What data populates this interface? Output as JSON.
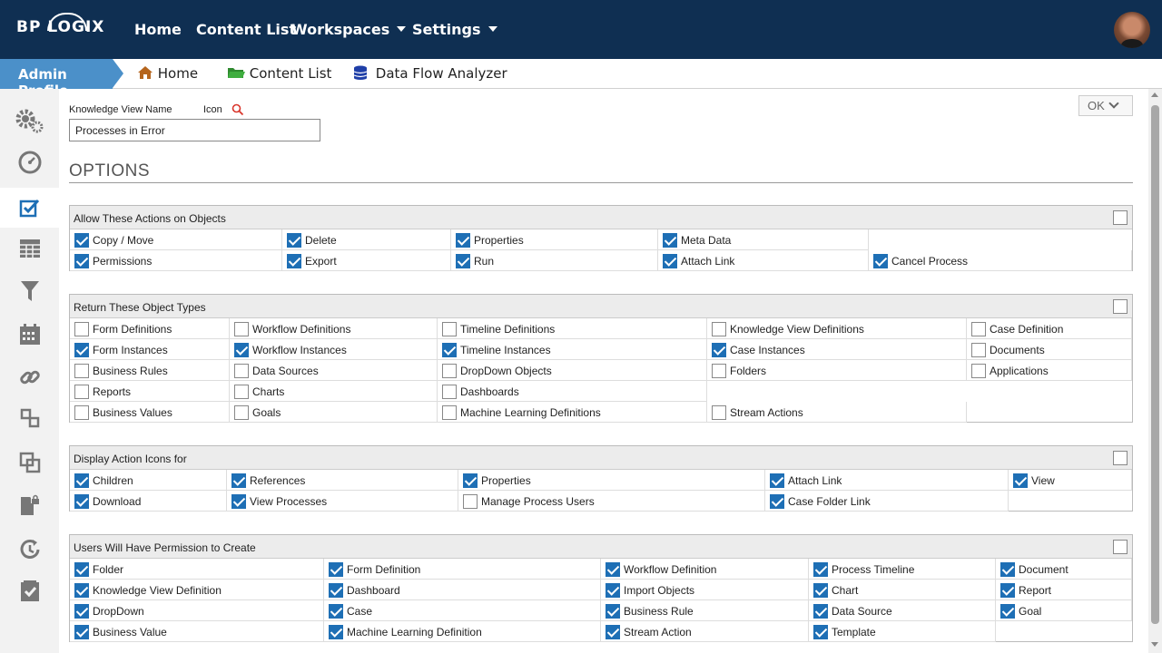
{
  "header": {
    "logo": "BP LOGIX",
    "nav": [
      "Home",
      "Content List",
      "Workspaces",
      "Settings"
    ]
  },
  "subbar": {
    "admin_label": "Admin Profile",
    "crumbs": [
      "Home",
      "Content List",
      "Data Flow Analyzer"
    ]
  },
  "sidebar": {
    "items": [
      "gear-icon",
      "dashboard-gauge-icon",
      "checklist-icon",
      "table-icon",
      "filter-icon",
      "calendar-icon",
      "link-icon",
      "hierarchy-icon",
      "layers-icon",
      "lock-file-icon",
      "refresh-clock-icon",
      "task-check-icon"
    ]
  },
  "form": {
    "kv_name_label": "Knowledge View Name",
    "icon_label": "Icon",
    "kv_name_value": "Processes in Error",
    "ok_label": "OK",
    "options_title": "OPTIONS"
  },
  "sections": [
    {
      "title": "Allow These Actions on Objects",
      "rows": [
        [
          {
            "label": "Copy / Move",
            "checked": true
          },
          {
            "label": "Delete",
            "checked": true
          },
          {
            "label": "Properties",
            "checked": true
          },
          {
            "label": "Meta Data",
            "checked": true
          },
          null
        ],
        [
          {
            "label": "Permissions",
            "checked": true
          },
          {
            "label": "Export",
            "checked": true
          },
          {
            "label": "Run",
            "checked": true
          },
          {
            "label": "Attach Link",
            "checked": true
          },
          {
            "label": "Cancel Process",
            "checked": true
          }
        ]
      ]
    },
    {
      "title": "Return These Object Types",
      "rows": [
        [
          {
            "label": "Form Definitions",
            "checked": false
          },
          {
            "label": "Workflow Definitions",
            "checked": false
          },
          {
            "label": "Timeline Definitions",
            "checked": false
          },
          {
            "label": "Knowledge View Definitions",
            "checked": false
          },
          {
            "label": "Case Definition",
            "checked": false
          }
        ],
        [
          {
            "label": "Form Instances",
            "checked": true
          },
          {
            "label": "Workflow Instances",
            "checked": true
          },
          {
            "label": "Timeline Instances",
            "checked": true
          },
          {
            "label": "Case Instances",
            "checked": true
          },
          {
            "label": "Documents",
            "checked": false
          }
        ],
        [
          {
            "label": "Business Rules",
            "checked": false
          },
          {
            "label": "Data Sources",
            "checked": false
          },
          {
            "label": "DropDown Objects",
            "checked": false
          },
          {
            "label": "Folders",
            "checked": false
          },
          {
            "label": "Applications",
            "checked": false
          }
        ],
        [
          {
            "label": "Reports",
            "checked": false
          },
          {
            "label": "Charts",
            "checked": false
          },
          {
            "label": "Dashboards",
            "checked": false
          },
          null,
          null
        ],
        [
          {
            "label": "Business Values",
            "checked": false
          },
          {
            "label": "Goals",
            "checked": false
          },
          {
            "label": "Machine Learning Definitions",
            "checked": false
          },
          {
            "label": "Stream Actions",
            "checked": false
          },
          null
        ]
      ]
    },
    {
      "title": "Display Action Icons for",
      "rows": [
        [
          {
            "label": "Children",
            "checked": true
          },
          {
            "label": "References",
            "checked": true
          },
          {
            "label": "Properties",
            "checked": true
          },
          {
            "label": "Attach Link",
            "checked": true
          },
          {
            "label": "View",
            "checked": true
          }
        ],
        [
          {
            "label": "Download",
            "checked": true
          },
          {
            "label": "View Processes",
            "checked": true
          },
          {
            "label": "Manage Process Users",
            "checked": false
          },
          {
            "label": "Case Folder Link",
            "checked": true
          },
          null
        ]
      ]
    },
    {
      "title": "Users Will Have Permission to Create",
      "rows": [
        [
          {
            "label": "Folder",
            "checked": true
          },
          {
            "label": "Form Definition",
            "checked": true
          },
          {
            "label": "Workflow Definition",
            "checked": true
          },
          {
            "label": "Process Timeline",
            "checked": true
          },
          {
            "label": "Document",
            "checked": true
          }
        ],
        [
          {
            "label": "Knowledge View Definition",
            "checked": true
          },
          {
            "label": "Dashboard",
            "checked": true
          },
          {
            "label": "Import Objects",
            "checked": true
          },
          {
            "label": "Chart",
            "checked": true
          },
          {
            "label": "Report",
            "checked": true
          }
        ],
        [
          {
            "label": "DropDown",
            "checked": true
          },
          {
            "label": "Case",
            "checked": true
          },
          {
            "label": "Business Rule",
            "checked": true
          },
          {
            "label": "Data Source",
            "checked": true
          },
          {
            "label": "Goal",
            "checked": true
          }
        ],
        [
          {
            "label": "Business Value",
            "checked": true
          },
          {
            "label": "Machine Learning Definition",
            "checked": true
          },
          {
            "label": "Stream Action",
            "checked": true
          },
          {
            "label": "Template",
            "checked": true
          },
          null
        ]
      ]
    }
  ]
}
